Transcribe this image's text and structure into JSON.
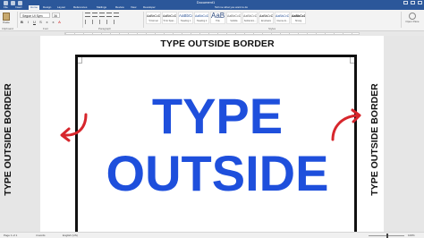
{
  "window": {
    "title": "Document1"
  },
  "ribbon": {
    "tabs": [
      "File",
      "Insert",
      "Home",
      "Design",
      "Layout",
      "References",
      "Mailings",
      "Review",
      "View",
      "Developer"
    ],
    "active_tab": "Home",
    "tell_me": "Tell me what you want to do",
    "font_name": "Segoe UI Sym",
    "font_size": "36",
    "group_labels": {
      "clipboard": "Clipboard",
      "font": "Font",
      "paragraph": "Paragraph",
      "styles": "Styles",
      "editing": "Editing"
    },
    "paste_label": "Paste",
    "styles": [
      {
        "sample": "AaBbCcDd",
        "name": "¶ Normal"
      },
      {
        "sample": "AaBbCcDd",
        "name": "¶ No Spac..."
      },
      {
        "sample": "AaBbCc",
        "name": "Heading 1"
      },
      {
        "sample": "AaBbCcD",
        "name": "Heading 2"
      },
      {
        "sample": "AaBb",
        "name": "Title"
      },
      {
        "sample": "AaBbCcD",
        "name": "Subtitle"
      },
      {
        "sample": "AaBbCcDd",
        "name": "Subtle Em..."
      },
      {
        "sample": "AaBbCcDd",
        "name": "Emphasis"
      },
      {
        "sample": "AaBbCcDd",
        "name": "Intense E..."
      },
      {
        "sample": "AaBbCcDd",
        "name": "Strong"
      }
    ],
    "editing_label": "Open Pane"
  },
  "document": {
    "top_label": "TYPE OUTSIDE BORDER",
    "left_label": "TYPE OUTSIDE BORDER",
    "right_label": "TYPE OUTSIDE BORDER",
    "big_line1": "TYPE",
    "big_line2": "OUTSIDE",
    "text_color": "#1e4fdc",
    "arrow_color": "#d7262c"
  },
  "status": {
    "page": "Page 1 of 1",
    "words": "4 words",
    "language": "English (US)",
    "zoom": "100%"
  }
}
